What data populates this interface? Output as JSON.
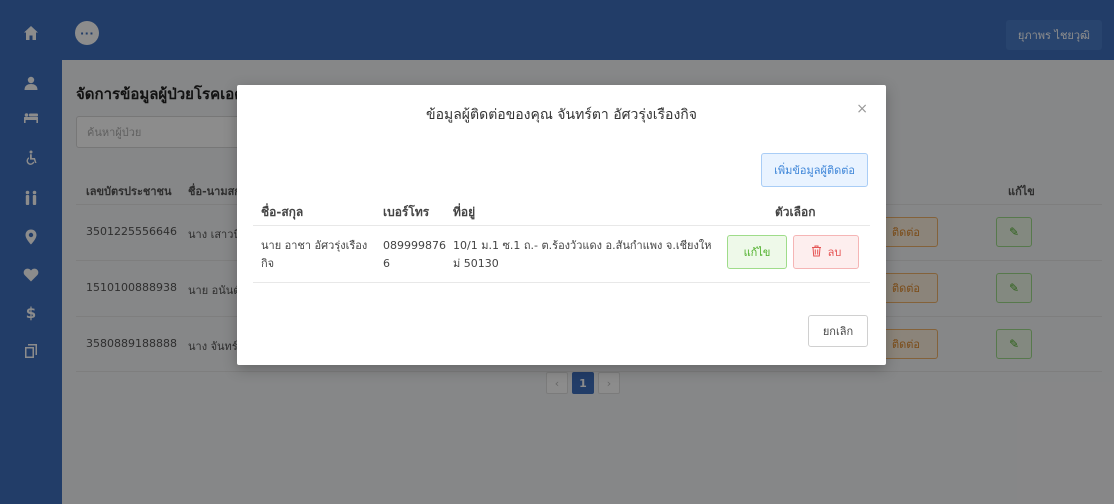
{
  "header": {
    "menu_label": "···",
    "user_name": "ยุภาพร ไชยวุฒิ"
  },
  "sidebar": {
    "items": [
      {
        "icon": "home-icon"
      },
      {
        "icon": "user-icon"
      },
      {
        "icon": "patient-bed-icon"
      },
      {
        "icon": "wheelchair-icon"
      },
      {
        "icon": "people-icon"
      },
      {
        "icon": "map-marker-icon"
      },
      {
        "icon": "heart-icon"
      },
      {
        "icon": "dollar-icon"
      },
      {
        "icon": "copy-icon"
      }
    ]
  },
  "main": {
    "title": "จัดการข้อมูลผู้ป่วยโรคเอดส์",
    "search_placeholder": "ค้นหาผู้ป่วย",
    "columns": [
      "เลขบัตรประชาชน",
      "ชื่อ-นามสกุล",
      "แก้ไข"
    ],
    "rows": [
      {
        "id": "3501225556646",
        "name": "นาง เสาวนี",
        "contact": "ติดต่อ",
        "edit": "✎"
      },
      {
        "id": "1510100888938",
        "name": "นาย อนันต์",
        "contact": "ติดต่อ",
        "edit": "✎"
      },
      {
        "id": "3580889188888",
        "name": "นาง จันทร์",
        "contact": "ติดต่อ",
        "edit": "✎"
      }
    ],
    "pagination": {
      "prev": "‹",
      "current": "1",
      "next": "›"
    }
  },
  "modal": {
    "title": "ข้อมูลผู้ติดต่อของคุณ จันทร์ตา อัศวรุ่งเรืองกิจ",
    "close": "×",
    "add_button": "เพิ่มข้อมูลผู้ติดต่อ",
    "columns": {
      "name": "ชื่อ-สกุล",
      "phone": "เบอร์โทร",
      "address": "ที่อยู่",
      "options": "ตัวเลือก"
    },
    "rows": [
      {
        "name_line1": "นาย อาชา อัศวรุ่งเรือง",
        "name_line2": "กิจ",
        "phone_line1": "089999876",
        "phone_line2": "6",
        "address_line1": "10/1 ม.1 ซ.1 ถ.- ต.ร้องวัวแดง อ.สันกำแพง จ.เชียงให",
        "address_line2": "ม่ 50130",
        "edit": "แก้ไข",
        "delete": "ลบ"
      }
    ],
    "cancel": "ยกเลิก"
  },
  "colors": {
    "primary": "#3e6fbd",
    "success": "#52b12e",
    "danger": "#e55353",
    "warning": "#e08a2b",
    "info": "#3d85d8"
  }
}
